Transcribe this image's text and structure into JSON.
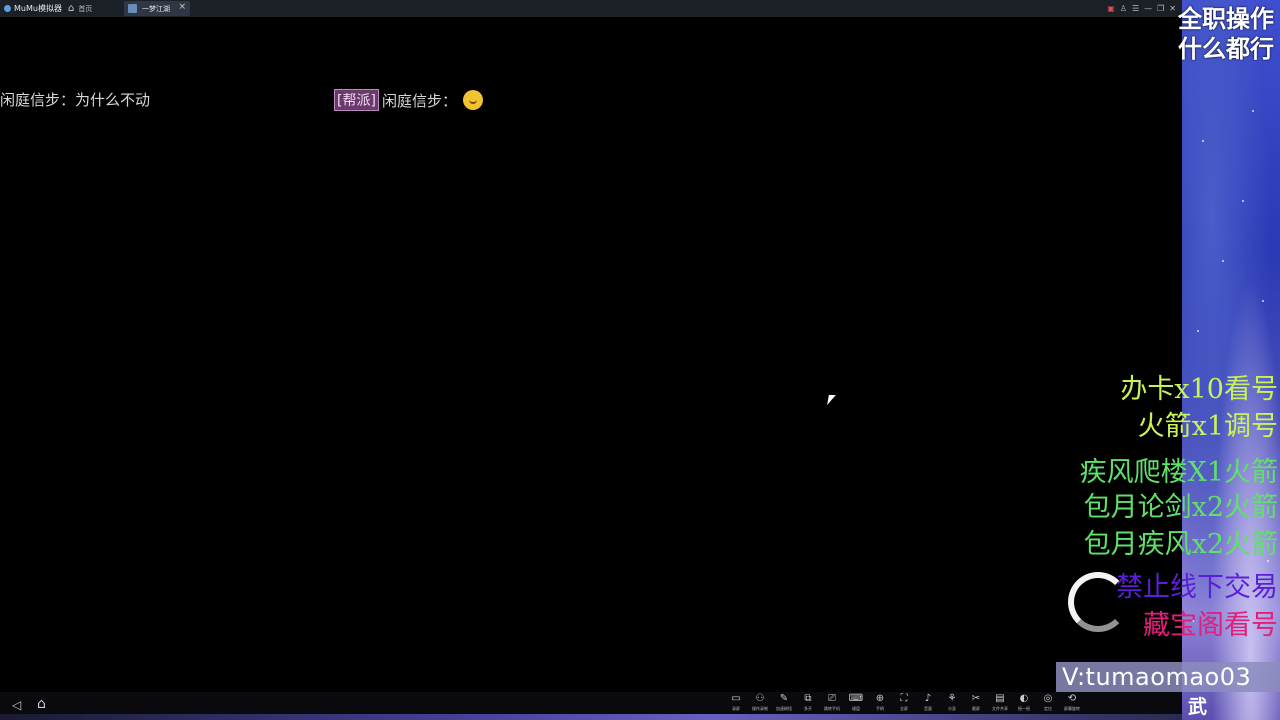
{
  "titlebar": {
    "app_name": "MuMu模拟器",
    "home_label": "首页",
    "tab_label": "一梦江湖",
    "tab_close": "×",
    "controls": [
      "▣",
      "♙",
      "☰",
      "—",
      "❐",
      "✕"
    ]
  },
  "chat": {
    "line1": "闲庭信步：为什么不动",
    "line2_tag": "[帮派]",
    "line2_text": "闲庭信步："
  },
  "promo": {
    "top_line1": "全职操作",
    "top_line2": "什么都行",
    "ad1": "办卡x10看号",
    "ad2": "火箭x1调号",
    "ad3": "疾风爬楼X1火箭",
    "ad4": "包月论剑x2火箭",
    "ad5": "包月疾风x2火箭",
    "ad6": "禁止线下交易",
    "ad7": "藏宝阁看号",
    "contact": "V:tumaomao03",
    "contact_sub": "武"
  },
  "navbar": {
    "back": "◁",
    "home": "⌂",
    "tools": [
      {
        "icon": "▭",
        "label": "录屏"
      },
      {
        "icon": "⚇",
        "label": "操作录制"
      },
      {
        "icon": "✎",
        "label": "加速刷怪"
      },
      {
        "icon": "⧉",
        "label": "多开"
      },
      {
        "icon": "⎚",
        "label": "跳转手机"
      },
      {
        "icon": "⌨",
        "label": "键盘"
      },
      {
        "icon": "⊕",
        "label": "手柄"
      },
      {
        "icon": "⛶",
        "label": "全屏"
      },
      {
        "icon": "♪",
        "label": "音量"
      },
      {
        "icon": "⚘",
        "label": "分身"
      },
      {
        "icon": "✂",
        "label": "截屏"
      },
      {
        "icon": "▤",
        "label": "文件共享"
      },
      {
        "icon": "◐",
        "label": "摇一摇"
      },
      {
        "icon": "◎",
        "label": "定位"
      },
      {
        "icon": "⟲",
        "label": "屏幕旋转"
      }
    ]
  }
}
